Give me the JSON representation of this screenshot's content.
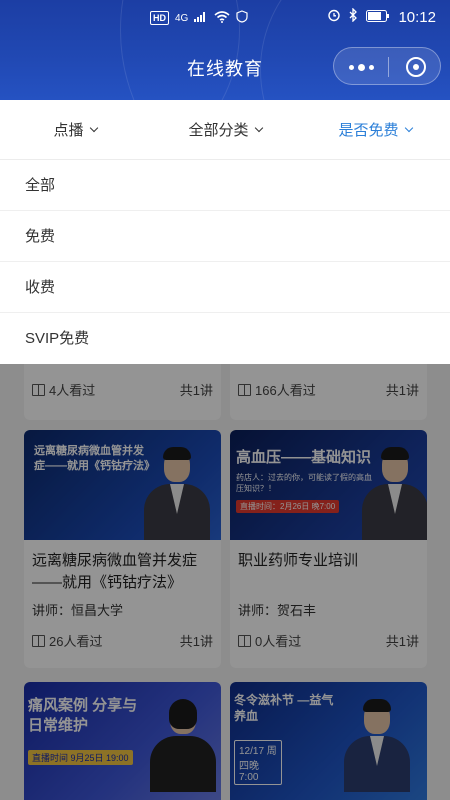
{
  "status_bar": {
    "network": "4G",
    "hd": "HD",
    "time": "10:12"
  },
  "header": {
    "title": "在线教育",
    "capsule": {
      "more": "more-icon",
      "close": "close-target-icon"
    }
  },
  "filters": [
    {
      "label": "点播",
      "active": false
    },
    {
      "label": "全部分类",
      "active": false
    },
    {
      "label": "是否免费",
      "active": true
    }
  ],
  "dropdown": {
    "options": [
      "全部",
      "免费",
      "收费",
      "SVIP免费"
    ]
  },
  "courses": [
    {
      "views": "4人看过",
      "lessons": "共1讲"
    },
    {
      "views": "166人看过",
      "lessons": "共1讲"
    },
    {
      "title": "远离糖尿病微血管并发症——就用《钙钴疗法》",
      "lecturer": "讲师：恒昌大学",
      "views": "26人看过",
      "lessons": "共1讲",
      "thumb_text": "远离糖尿病微血管并发症——就用《钙钴疗法》"
    },
    {
      "title": "职业药师专业培训",
      "lecturer": "讲师：贺石丰",
      "views": "0人看过",
      "lessons": "共1讲",
      "thumb_text": "高血压——基础知识",
      "thumb_sub": "药店人：过去的你，可能读了假的高血压知识？！",
      "thumb_time": "直播时间：2月26日 晚7:00"
    },
    {
      "thumb_text": "痛风案例 分享与日常维护",
      "thumb_time": "直播时间 9月25日 19:00"
    },
    {
      "thumb_text": "冬令滋补节 —益气养血",
      "thumb_time": "12/17 周四晚7:00"
    }
  ],
  "colors": {
    "accent": "#2b7fd8",
    "header": "#2149b4"
  }
}
